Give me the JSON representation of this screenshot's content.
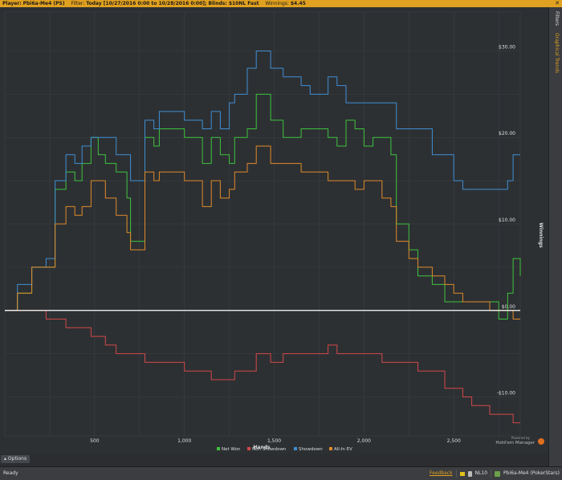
{
  "header": {
    "player_label": "Player:",
    "player_value": "Pbi6a-Me4 (PS)",
    "filter_label": "Filter:",
    "filter_value": "Today [10/27/2016 0:00 to 10/28/2016 0:00]; Blinds: $10NL Fast",
    "winnings_label": "Winnings:",
    "winnings_value": "$4.45",
    "close_icon": "close-icon"
  },
  "sidebar": {
    "tabs": [
      {
        "label": "Filters",
        "active": false
      },
      {
        "label": "Graphical Trends",
        "active": true
      }
    ]
  },
  "logo": {
    "line1": "Powered by",
    "line2": "Hold'em Manager"
  },
  "options": {
    "label": "Options"
  },
  "status": {
    "ready": "Ready",
    "feedback": "Feedback",
    "db": "NL10",
    "player": "Pbi6a-Me4 (PokerStars)"
  },
  "chart_data": {
    "type": "line",
    "xlabel": "Hands",
    "ylabel": "Winnings",
    "xlim": [
      0,
      2870
    ],
    "ylim": [
      -14.5,
      34.5
    ],
    "xticks": [
      500,
      1000,
      1500,
      2000,
      2500
    ],
    "xtick_labels": [
      "500",
      "1,000",
      "1,500",
      "2,000",
      "2,500"
    ],
    "yticks": [
      -10,
      0,
      10,
      20,
      30
    ],
    "ytick_labels": [
      "-$10.00",
      "$0.00",
      "$10.00",
      "$20.00",
      "$30.00"
    ],
    "grid": true,
    "legend_position": "bottom",
    "colors": {
      "net_won": "#3dc43d",
      "non_showdown": "#d44848",
      "showdown": "#3f8fd4",
      "all_in_ev": "#e08a2a",
      "zero_line": "#ffffff"
    },
    "series": [
      {
        "name": "Net Won",
        "color": "#3dc43d",
        "x": [
          0,
          70,
          150,
          230,
          280,
          340,
          390,
          430,
          480,
          520,
          560,
          620,
          680,
          700,
          780,
          830,
          860,
          1000,
          1100,
          1150,
          1200,
          1250,
          1280,
          1350,
          1400,
          1480,
          1550,
          1650,
          1700,
          1800,
          1850,
          1900,
          1950,
          2000,
          2050,
          2100,
          2150,
          2180,
          2250,
          2300,
          2380,
          2450,
          2500,
          2550,
          2600,
          2700,
          2750,
          2800,
          2830,
          2870
        ],
        "y": [
          0,
          2,
          5,
          5,
          14,
          16,
          15,
          17,
          20,
          18,
          17,
          16,
          13,
          8,
          20,
          19,
          21,
          20,
          17,
          20,
          18,
          17,
          20,
          21,
          25,
          22,
          20,
          21,
          21,
          20,
          19,
          22,
          21,
          19,
          20,
          20,
          18,
          10,
          7,
          4,
          3,
          1,
          1,
          1,
          1,
          1,
          -1,
          2,
          6,
          4
        ]
      },
      {
        "name": "Non Showdown",
        "color": "#d44848",
        "x": [
          0,
          70,
          150,
          230,
          280,
          340,
          390,
          430,
          480,
          520,
          560,
          620,
          680,
          700,
          780,
          830,
          860,
          1000,
          1100,
          1150,
          1200,
          1250,
          1280,
          1350,
          1400,
          1480,
          1550,
          1650,
          1700,
          1800,
          1850,
          1900,
          1950,
          2000,
          2050,
          2100,
          2150,
          2180,
          2250,
          2300,
          2380,
          2450,
          2500,
          2550,
          2600,
          2700,
          2750,
          2800,
          2830,
          2870
        ],
        "y": [
          0,
          0,
          0,
          -1,
          -1,
          -2,
          -2,
          -2,
          -3,
          -3,
          -4,
          -5,
          -5,
          -5,
          -6,
          -6,
          -6,
          -7,
          -7,
          -8,
          -8,
          -8,
          -7,
          -7,
          -5,
          -6,
          -5,
          -5,
          -5,
          -4,
          -5,
          -5,
          -5,
          -5,
          -5,
          -6,
          -6,
          -6,
          -6,
          -7,
          -7,
          -9,
          -9,
          -10,
          -11,
          -12,
          -12,
          -12,
          -13,
          -13
        ]
      },
      {
        "name": "Showdown",
        "color": "#3f8fd4",
        "x": [
          0,
          70,
          150,
          230,
          280,
          340,
          390,
          430,
          480,
          520,
          560,
          620,
          680,
          700,
          780,
          830,
          860,
          1000,
          1100,
          1150,
          1200,
          1250,
          1280,
          1350,
          1400,
          1480,
          1550,
          1650,
          1700,
          1800,
          1850,
          1900,
          1950,
          2000,
          2050,
          2100,
          2150,
          2180,
          2250,
          2300,
          2380,
          2450,
          2500,
          2550,
          2600,
          2700,
          2750,
          2800,
          2830,
          2870
        ],
        "y": [
          0,
          3,
          5,
          6,
          15,
          18,
          17,
          19,
          20,
          20,
          20,
          18,
          18,
          15,
          22,
          21,
          23,
          22,
          21,
          23,
          21,
          24,
          25,
          28,
          30,
          28,
          27,
          26,
          25,
          27,
          26,
          24,
          24,
          24,
          24,
          24,
          24,
          21,
          21,
          21,
          18,
          18,
          15,
          14,
          14,
          14,
          14,
          15,
          18,
          18
        ]
      },
      {
        "name": "All-In EV",
        "color": "#e08a2a",
        "x": [
          0,
          70,
          150,
          230,
          280,
          340,
          390,
          430,
          480,
          520,
          560,
          620,
          680,
          700,
          780,
          830,
          860,
          1000,
          1100,
          1150,
          1200,
          1250,
          1280,
          1350,
          1400,
          1480,
          1550,
          1650,
          1700,
          1800,
          1850,
          1900,
          1950,
          2000,
          2050,
          2100,
          2150,
          2180,
          2250,
          2300,
          2380,
          2450,
          2500,
          2550,
          2600,
          2700,
          2750,
          2800,
          2830,
          2870
        ],
        "y": [
          0,
          2,
          5,
          5,
          10,
          12,
          11,
          12,
          15,
          15,
          13,
          11,
          9,
          7,
          16,
          15,
          16,
          15,
          12,
          15,
          13,
          14,
          16,
          17,
          19,
          17,
          17,
          16,
          16,
          15,
          15,
          15,
          14,
          15,
          15,
          13,
          12,
          8,
          6,
          5,
          4,
          3,
          2,
          1,
          1,
          0,
          0,
          0,
          -1,
          -1
        ]
      }
    ]
  }
}
